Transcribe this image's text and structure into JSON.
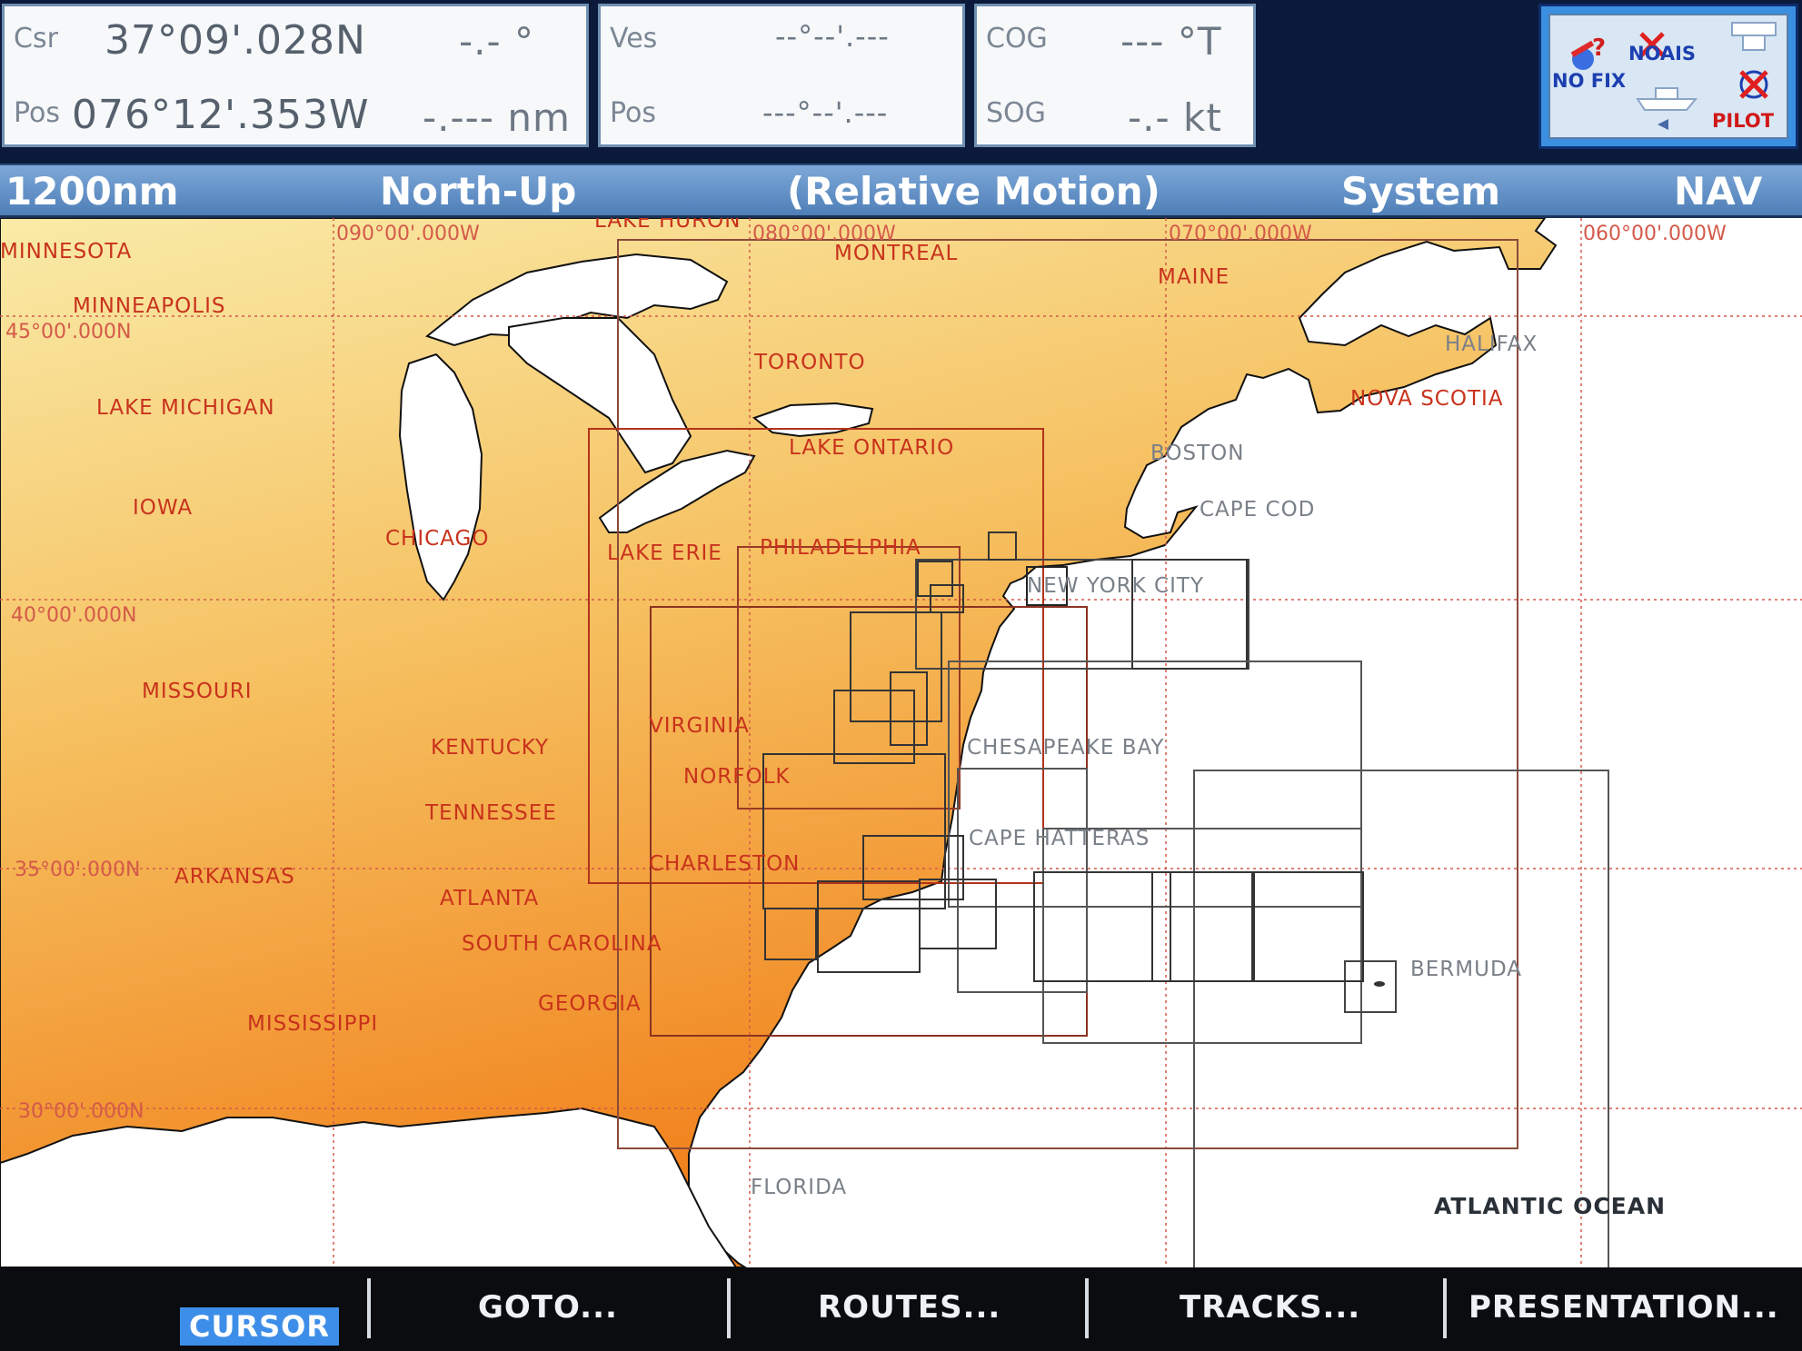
{
  "info": {
    "cursor": {
      "label1": "Csr",
      "label2": "Pos",
      "lat": "37°09'.028N",
      "lon": "076°12'.353W",
      "bearing": "-.- °",
      "range": "-.--- nm"
    },
    "vessel": {
      "label1": "Ves",
      "label2": "Pos",
      "lat": "--°--'.---",
      "lon": "---°--'.---"
    },
    "course": {
      "cog_label": "COG",
      "sog_label": "SOG",
      "cog": "--- °T",
      "sog": "-.- kt"
    }
  },
  "status": {
    "no_fix": "NO FIX",
    "no_ais": "NOAIS",
    "pilot": "PILOT"
  },
  "titlebar": {
    "scale": "1200nm",
    "orientation": "North-Up",
    "motion": "(Relative Motion)",
    "datum": "System",
    "mode": "NAV"
  },
  "map": {
    "grid_labels": {
      "lon90": "090°00'.000W",
      "lon80": "080°00'.000W",
      "lon70": "070°00'.000W",
      "lon60": "060°00'.000W",
      "lat45": "45°00'.000N",
      "lat40": "40°00'.000N",
      "lat35": "35°00'.000N",
      "lat30": "30°00'.000N"
    },
    "places": {
      "minnesota": "MINNESOTA",
      "minneapolis": "MINNEAPOLIS",
      "lake_michigan": "LAKE MICHIGAN",
      "iowa": "IOWA",
      "chicago": "CHICAGO",
      "missouri": "MISSOURI",
      "kentucky": "KENTUCKY",
      "tennessee": "TENNESSEE",
      "arkansas": "ARKANSAS",
      "atlanta": "ATLANTA",
      "south_carolina": "SOUTH CAROLINA",
      "mississippi": "MISSISSIPPI",
      "georgia": "GEORGIA",
      "florida": "FLORIDA",
      "lake_huron": "LAKE HURON",
      "montreal": "MONTREAL",
      "toronto": "TORONTO",
      "lake_ontario": "LAKE ONTARIO",
      "lake_erie": "LAKE ERIE",
      "philadelphia": "PHILADELPHIA",
      "virginia": "VIRGINIA",
      "norfolk": "NORFOLK",
      "charleston": "CHARLESTON",
      "maine": "MAINE",
      "halifax": "HALIFAX",
      "nova_scotia": "NOVA SCOTIA",
      "boston": "BOSTON",
      "cape_cod": "CAPE COD",
      "new_york_city": "NEW YORK CITY",
      "chesapeake_bay": "CHESAPEAKE BAY",
      "cape_hatteras": "CAPE HATTERAS",
      "bermuda": "BERMUDA",
      "atlantic_ocean": "ATLANTIC OCEAN"
    },
    "colors": {
      "land_light": "#f7e8a2",
      "land_dark": "#f08a1c",
      "chart_border": "#b3321a",
      "grid": "#d45a4a"
    }
  },
  "softkeys": {
    "cursor": "CURSOR",
    "goto": "GOTO...",
    "routes": "ROUTES...",
    "tracks": "TRACKS...",
    "presentation": "PRESENTATION..."
  }
}
